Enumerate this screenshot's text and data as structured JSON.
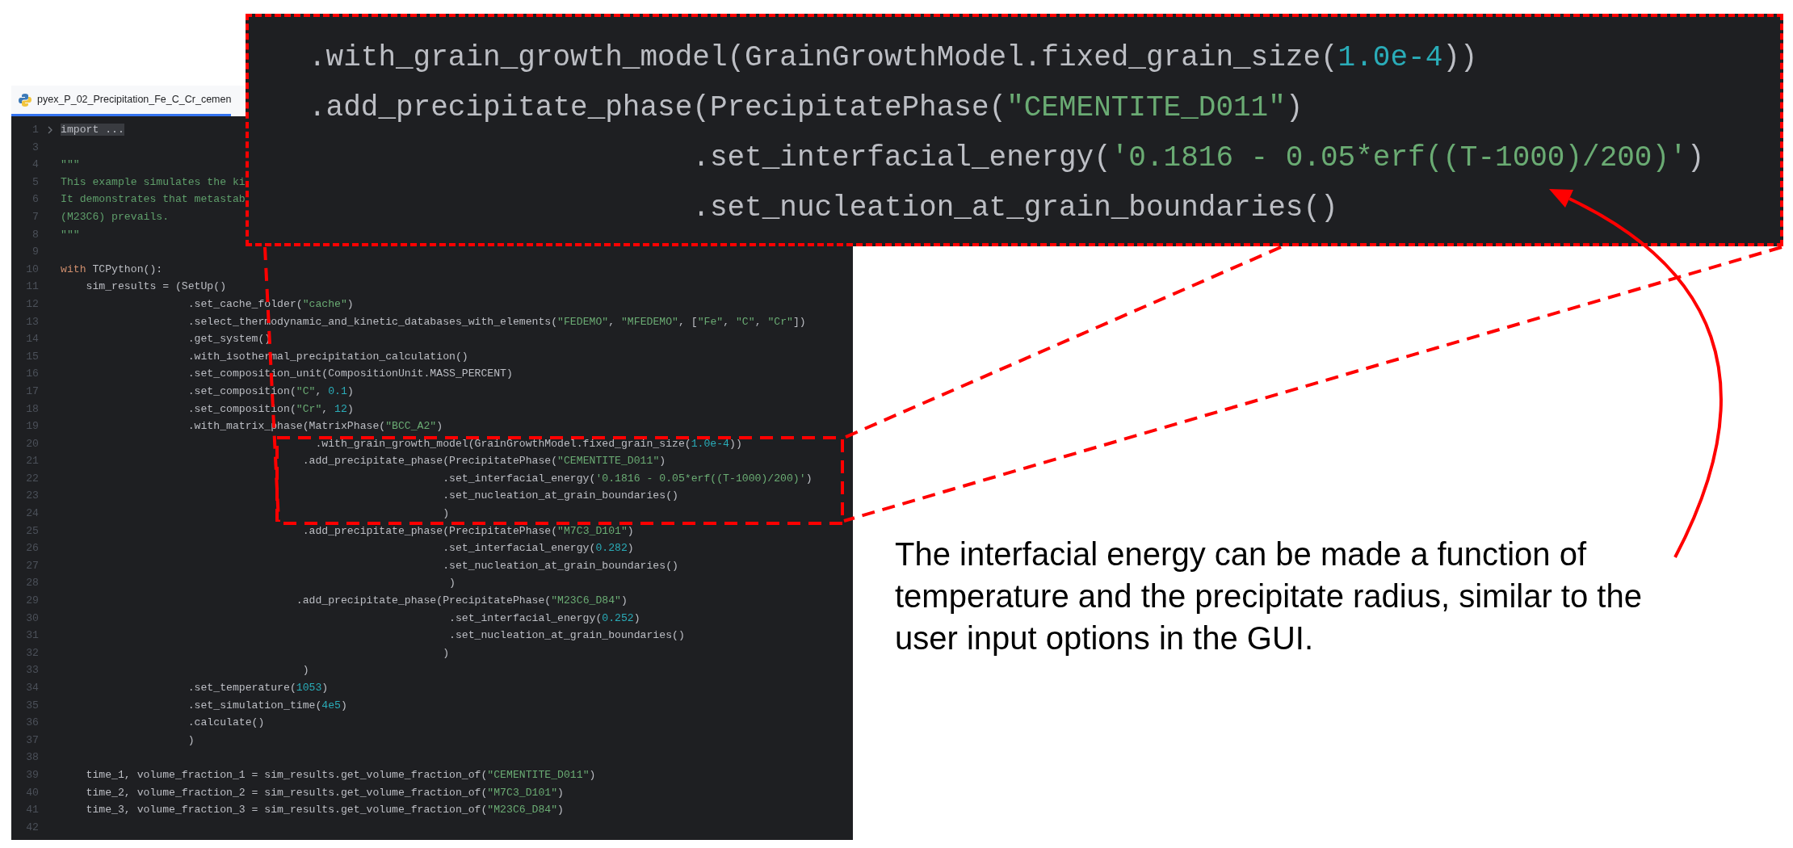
{
  "editor": {
    "tab": {
      "title": "pyex_P_02_Precipitation_Fe_C_Cr_cemen",
      "selected": true
    },
    "lines": [
      {
        "number": "1",
        "segments": [
          {
            "kind": "fold",
            "text": "import ..."
          }
        ]
      },
      {
        "number": "3"
      },
      {
        "number": "4",
        "segments": [
          {
            "kind": "d",
            "text": "\"\"\""
          }
        ]
      },
      {
        "number": "5",
        "segments": [
          {
            "kind": "d",
            "text": "This example simulates the ki"
          }
        ]
      },
      {
        "number": "6",
        "segments": [
          {
            "kind": "d",
            "text": "It demonstrates that metastab"
          }
        ]
      },
      {
        "number": "7",
        "segments": [
          {
            "kind": "d",
            "text": "(M23C6) prevails."
          }
        ]
      },
      {
        "number": "8",
        "segments": [
          {
            "kind": "d",
            "text": "\"\"\""
          }
        ]
      },
      {
        "number": "9"
      },
      {
        "number": "10",
        "segments": [
          {
            "kind": "k",
            "text": "with"
          },
          {
            "kind": "p",
            "text": " TCPython():"
          }
        ]
      },
      {
        "number": "11",
        "segments": [
          {
            "kind": "p",
            "text": "    sim_results = (SetUp()"
          }
        ]
      },
      {
        "number": "12",
        "segments": [
          {
            "kind": "p",
            "text": "                    .set_cache_folder("
          },
          {
            "kind": "s",
            "text": "\"cache\""
          },
          {
            "kind": "p",
            "text": ")"
          }
        ]
      },
      {
        "number": "13",
        "segments": [
          {
            "kind": "p",
            "text": "                    .select_thermodynamic_and_kinetic_databases_with_elements("
          },
          {
            "kind": "s",
            "text": "\"FEDEMO\""
          },
          {
            "kind": "p",
            "text": ", "
          },
          {
            "kind": "s",
            "text": "\"MFEDEMO\""
          },
          {
            "kind": "p",
            "text": ", ["
          },
          {
            "kind": "s",
            "text": "\"Fe\""
          },
          {
            "kind": "p",
            "text": ", "
          },
          {
            "kind": "s",
            "text": "\"C\""
          },
          {
            "kind": "p",
            "text": ", "
          },
          {
            "kind": "s",
            "text": "\"Cr\""
          },
          {
            "kind": "p",
            "text": "])"
          }
        ]
      },
      {
        "number": "14",
        "segments": [
          {
            "kind": "p",
            "text": "                    .get_system()"
          }
        ]
      },
      {
        "number": "15",
        "segments": [
          {
            "kind": "p",
            "text": "                    .with_isothermal_precipitation_calculation()"
          }
        ]
      },
      {
        "number": "16",
        "segments": [
          {
            "kind": "p",
            "text": "                    .set_composition_unit(CompositionUnit.MASS_PERCENT)"
          }
        ]
      },
      {
        "number": "17",
        "segments": [
          {
            "kind": "p",
            "text": "                    .set_composition("
          },
          {
            "kind": "s",
            "text": "\"C\""
          },
          {
            "kind": "p",
            "text": ", "
          },
          {
            "kind": "n",
            "text": "0.1"
          },
          {
            "kind": "p",
            "text": ")"
          }
        ]
      },
      {
        "number": "18",
        "segments": [
          {
            "kind": "p",
            "text": "                    .set_composition("
          },
          {
            "kind": "s",
            "text": "\"Cr\""
          },
          {
            "kind": "p",
            "text": ", "
          },
          {
            "kind": "n",
            "text": "12"
          },
          {
            "kind": "p",
            "text": ")"
          }
        ]
      },
      {
        "number": "19",
        "segments": [
          {
            "kind": "p",
            "text": "                    .with_matrix_phase(MatrixPhase("
          },
          {
            "kind": "s",
            "text": "\"BCC_A2\""
          },
          {
            "kind": "p",
            "text": ")"
          }
        ]
      },
      {
        "number": "20",
        "segments": [
          {
            "kind": "p",
            "text": "                                        .with_grain_growth_model(GrainGrowthModel.fixed_grain_size("
          },
          {
            "kind": "n",
            "text": "1.0e-4"
          },
          {
            "kind": "p",
            "text": "))"
          }
        ]
      },
      {
        "number": "21",
        "segments": [
          {
            "kind": "p",
            "text": "                                      .add_precipitate_phase(PrecipitatePhase("
          },
          {
            "kind": "s",
            "text": "\"CEMENTITE_D011\""
          },
          {
            "kind": "p",
            "text": ")"
          }
        ]
      },
      {
        "number": "22",
        "segments": [
          {
            "kind": "p",
            "text": "                                                            .set_interfacial_energy("
          },
          {
            "kind": "s",
            "text": "'0.1816 - 0.05*erf((T-1000)/200)'"
          },
          {
            "kind": "p",
            "text": ")"
          }
        ]
      },
      {
        "number": "23",
        "segments": [
          {
            "kind": "p",
            "text": "                                                            .set_nucleation_at_grain_boundaries()"
          }
        ]
      },
      {
        "number": "24",
        "segments": [
          {
            "kind": "p",
            "text": "                                                            )"
          }
        ]
      },
      {
        "number": "25",
        "segments": [
          {
            "kind": "p",
            "text": "                                      .add_precipitate_phase(PrecipitatePhase("
          },
          {
            "kind": "s",
            "text": "\"M7C3_D101\""
          },
          {
            "kind": "p",
            "text": ")"
          }
        ]
      },
      {
        "number": "26",
        "segments": [
          {
            "kind": "p",
            "text": "                                                            .set_interfacial_energy("
          },
          {
            "kind": "n",
            "text": "0.282"
          },
          {
            "kind": "p",
            "text": ")"
          }
        ]
      },
      {
        "number": "27",
        "segments": [
          {
            "kind": "p",
            "text": "                                                            .set_nucleation_at_grain_boundaries()"
          }
        ]
      },
      {
        "number": "28",
        "segments": [
          {
            "kind": "p",
            "text": "                                                             )"
          }
        ]
      },
      {
        "number": "29",
        "segments": [
          {
            "kind": "p",
            "text": "                                     .add_precipitate_phase(PrecipitatePhase("
          },
          {
            "kind": "s",
            "text": "\"M23C6_D84\""
          },
          {
            "kind": "p",
            "text": ")"
          }
        ]
      },
      {
        "number": "30",
        "segments": [
          {
            "kind": "p",
            "text": "                                                             .set_interfacial_energy("
          },
          {
            "kind": "n",
            "text": "0.252"
          },
          {
            "kind": "p",
            "text": ")"
          }
        ]
      },
      {
        "number": "31",
        "segments": [
          {
            "kind": "p",
            "text": "                                                             .set_nucleation_at_grain_boundaries()"
          }
        ]
      },
      {
        "number": "32",
        "segments": [
          {
            "kind": "p",
            "text": "                                                            )"
          }
        ]
      },
      {
        "number": "33",
        "segments": [
          {
            "kind": "p",
            "text": "                                      )"
          }
        ]
      },
      {
        "number": "34",
        "segments": [
          {
            "kind": "p",
            "text": "                    .set_temperature("
          },
          {
            "kind": "n",
            "text": "1053"
          },
          {
            "kind": "p",
            "text": ")"
          }
        ]
      },
      {
        "number": "35",
        "segments": [
          {
            "kind": "p",
            "text": "                    .set_simulation_time("
          },
          {
            "kind": "n",
            "text": "4e5"
          },
          {
            "kind": "p",
            "text": ")"
          }
        ]
      },
      {
        "number": "36",
        "segments": [
          {
            "kind": "p",
            "text": "                    .calculate()"
          }
        ]
      },
      {
        "number": "37",
        "segments": [
          {
            "kind": "p",
            "text": "                    )"
          }
        ]
      },
      {
        "number": "38"
      },
      {
        "number": "39",
        "segments": [
          {
            "kind": "p",
            "text": "    time_1, volume_fraction_1 = sim_results.get_volume_fraction_of("
          },
          {
            "kind": "s",
            "text": "\"CEMENTITE_D011\""
          },
          {
            "kind": "p",
            "text": ")"
          }
        ]
      },
      {
        "number": "40",
        "segments": [
          {
            "kind": "p",
            "text": "    time_2, volume_fraction_2 = sim_results.get_volume_fraction_of("
          },
          {
            "kind": "s",
            "text": "\"M7C3_D101\""
          },
          {
            "kind": "p",
            "text": ")"
          }
        ]
      },
      {
        "number": "41",
        "segments": [
          {
            "kind": "p",
            "text": "    time_3, volume_fraction_3 = sim_results.get_volume_fraction_of("
          },
          {
            "kind": "s",
            "text": "\"M23C6_D84\""
          },
          {
            "kind": "p",
            "text": ")"
          }
        ]
      },
      {
        "number": "42"
      }
    ]
  },
  "callout": {
    "lines": [
      {
        "segments": [
          {
            "kind": "p",
            "text": ".with_grain_growth_model(GrainGrowthModel.fixed_grain_size("
          },
          {
            "kind": "n",
            "text": "1.0e-4"
          },
          {
            "kind": "p",
            "text": "))"
          }
        ]
      },
      {
        "segments": [
          {
            "kind": "p",
            "text": ".add_precipitate_phase(PrecipitatePhase("
          },
          {
            "kind": "s",
            "text": "\"CEMENTITE_D011\""
          },
          {
            "kind": "p",
            "text": ")"
          }
        ]
      },
      {
        "segments": [
          {
            "kind": "p",
            "text": "                      .set_interfacial_energy("
          },
          {
            "kind": "s",
            "text": "'0.1816 - 0.05*erf((T-1000)/200)'"
          },
          {
            "kind": "p",
            "text": ")"
          }
        ]
      },
      {
        "segments": [
          {
            "kind": "p",
            "text": "                      .set_nucleation_at_grain_boundaries()"
          }
        ]
      }
    ]
  },
  "note": "The interfacial energy can be made a function of temperature and the precipitate radius, similar to the user input options in the GUI."
}
